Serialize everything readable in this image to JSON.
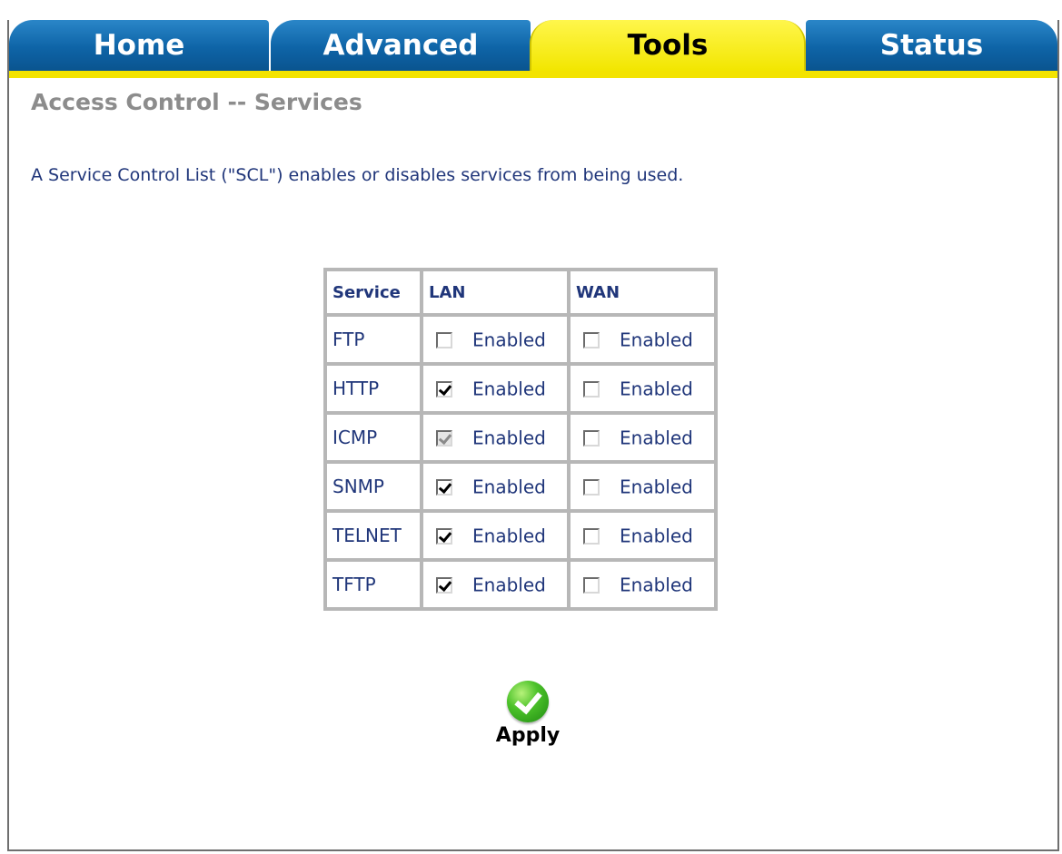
{
  "tabs": {
    "home": "Home",
    "advanced": "Advanced",
    "tools": "Tools",
    "status": "Status",
    "active": "Tools"
  },
  "page": {
    "title": "Access Control -- Services",
    "description": "A Service Control List (\"SCL\") enables or disables services from being used."
  },
  "table": {
    "headers": {
      "service": "Service",
      "lan": "LAN",
      "wan": "WAN"
    },
    "enabled_label": "Enabled",
    "rows": [
      {
        "service": "FTP",
        "lan_checked": false,
        "lan_disabled": false,
        "wan_checked": false
      },
      {
        "service": "HTTP",
        "lan_checked": true,
        "lan_disabled": false,
        "wan_checked": false
      },
      {
        "service": "ICMP",
        "lan_checked": true,
        "lan_disabled": true,
        "wan_checked": false
      },
      {
        "service": "SNMP",
        "lan_checked": true,
        "lan_disabled": false,
        "wan_checked": false
      },
      {
        "service": "TELNET",
        "lan_checked": true,
        "lan_disabled": false,
        "wan_checked": false
      },
      {
        "service": "TFTP",
        "lan_checked": true,
        "lan_disabled": false,
        "wan_checked": false
      }
    ]
  },
  "apply": {
    "label": "Apply",
    "icon": "check-icon"
  },
  "colors": {
    "tab_blue": "#0e64a7",
    "tab_active_yellow": "#f2e600",
    "text_blue": "#20367a",
    "title_gray": "#8c8c8c"
  }
}
